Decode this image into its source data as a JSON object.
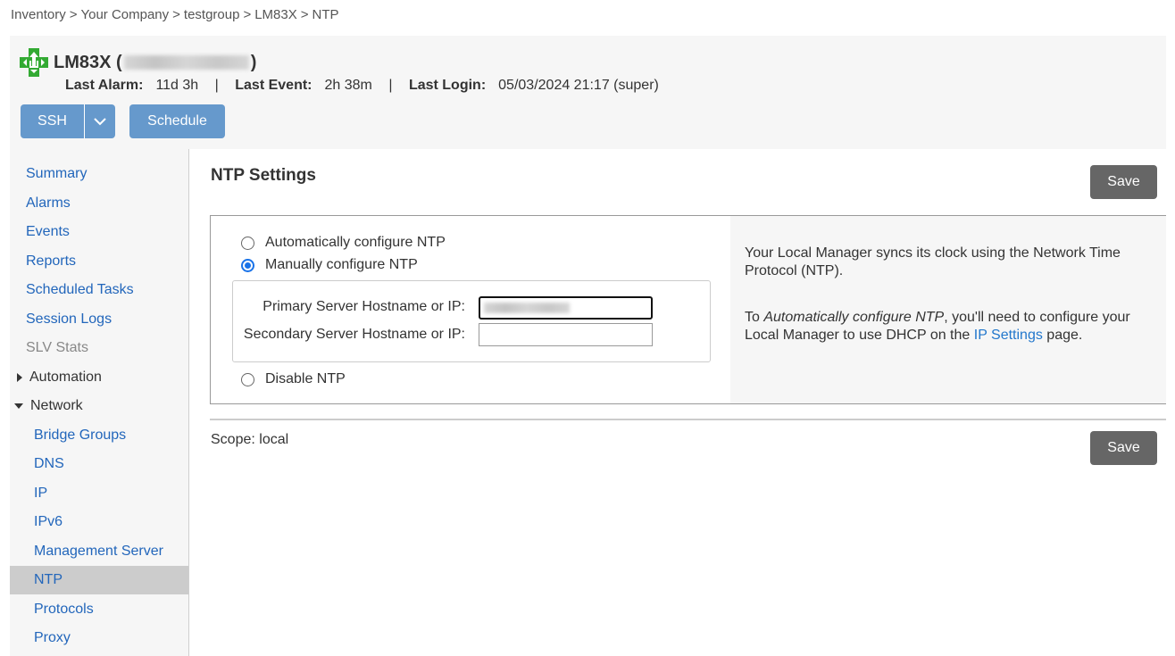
{
  "breadcrumb": [
    "Inventory",
    "Your Company",
    "testgroup",
    "LM83X",
    "NTP"
  ],
  "breadcrumb_separator": ">",
  "device": {
    "name": "LM83X",
    "ip_redacted": true,
    "logo_color": "#33aa33",
    "last_alarm_label": "Last Alarm:",
    "last_alarm_value": "11d 3h",
    "last_event_label": "Last Event:",
    "last_event_value": "2h 38m",
    "last_login_label": "Last Login:",
    "last_login_value": "05/03/2024 21:17 (super)",
    "divider": "|"
  },
  "toolbar": {
    "ssh_label": "SSH",
    "schedule_label": "Schedule",
    "accent_color": "#6699cc"
  },
  "sidebar": {
    "items": [
      {
        "label": "Summary",
        "type": "link"
      },
      {
        "label": "Alarms",
        "type": "link"
      },
      {
        "label": "Events",
        "type": "link"
      },
      {
        "label": "Reports",
        "type": "link"
      },
      {
        "label": "Scheduled Tasks",
        "type": "link"
      },
      {
        "label": "Session Logs",
        "type": "link"
      },
      {
        "label": "SLV Stats",
        "type": "disabled"
      },
      {
        "label": "Automation",
        "type": "group",
        "expanded": false
      },
      {
        "label": "Network",
        "type": "group",
        "expanded": true
      },
      {
        "label": "Bridge Groups",
        "type": "sublink"
      },
      {
        "label": "DNS",
        "type": "sublink"
      },
      {
        "label": "IP",
        "type": "sublink"
      },
      {
        "label": "IPv6",
        "type": "sublink"
      },
      {
        "label": "Management Server",
        "type": "sublink"
      },
      {
        "label": "NTP",
        "type": "sublink",
        "active": true
      },
      {
        "label": "Protocols",
        "type": "sublink"
      },
      {
        "label": "Proxy",
        "type": "sublink"
      }
    ]
  },
  "main": {
    "title": "NTP Settings",
    "save_label": "Save",
    "options": {
      "auto": "Automatically configure NTP",
      "manual": "Manually configure NTP",
      "disable": "Disable NTP",
      "selected": "manual"
    },
    "fields": {
      "primary_label": "Primary Server Hostname or IP:",
      "primary_value_redacted": true,
      "secondary_label": "Secondary Server Hostname or IP:",
      "secondary_value": ""
    },
    "help": {
      "para1": "Your Local Manager syncs its clock using the Network Time Protocol (NTP).",
      "para2_prefix": "To ",
      "para2_italic": "Automatically configure NTP",
      "para2_middle": ", you'll need to configure your Local Manager to use DHCP on the ",
      "para2_link": "IP Settings",
      "para2_suffix": " page."
    },
    "scope_text": "Scope: local"
  }
}
